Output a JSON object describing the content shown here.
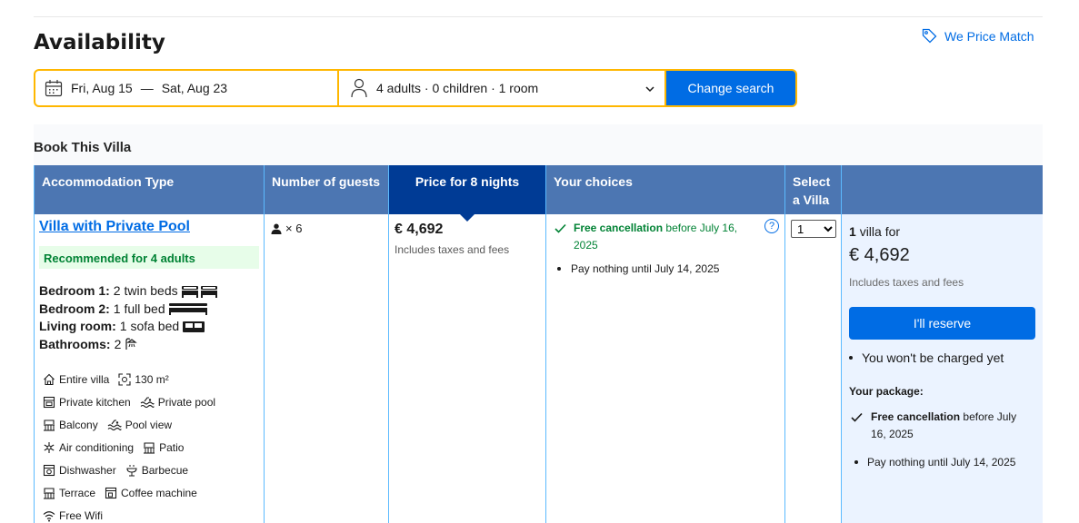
{
  "header": {
    "title": "Availability",
    "price_match": "We Price Match"
  },
  "search": {
    "check_in": "Fri, Aug 15",
    "separator": "—",
    "check_out": "Sat, Aug 23",
    "guests": "4 adults · 0 children · 1 room",
    "button": "Change search"
  },
  "book": {
    "title": "Book This Villa"
  },
  "table": {
    "headers": {
      "accommodation": "Accommodation Type",
      "guests": "Number of guests",
      "price": "Price for 8 nights",
      "choices": "Your choices",
      "select": "Select a Villa"
    },
    "villa": {
      "name": "Villa with Private Pool",
      "recommended": "Recommended for 4 adults",
      "bedrooms": [
        {
          "label": "Bedroom 1:",
          "value": "2 twin beds"
        },
        {
          "label": "Bedroom 2:",
          "value": "1 full bed"
        },
        {
          "label": "Living room:",
          "value": "1 sofa bed"
        },
        {
          "label": "Bathrooms:",
          "value": "2"
        }
      ],
      "facilities": [
        [
          "Entire villa",
          "130 m²"
        ],
        [
          "Private kitchen",
          "Private pool"
        ],
        [
          "Balcony",
          "Pool view"
        ],
        [
          "Air conditioning",
          "Patio"
        ],
        [
          "Dishwasher",
          "Barbecue"
        ],
        [
          "Terrace",
          "Coffee machine"
        ],
        [
          "Free Wifi"
        ]
      ]
    },
    "guests_count": "× 6",
    "price": "€ 4,692",
    "price_note": "Includes taxes and fees",
    "choices": {
      "free_cancel_bold": "Free cancellation",
      "free_cancel_rest": "before July 16, 2025",
      "pay_nothing": "Pay nothing until July 14, 2025",
      "help": "?"
    },
    "select_value": "1"
  },
  "summary": {
    "count": "1",
    "villa_for": "villa for",
    "price": "€ 4,692",
    "price_note": "Includes taxes and fees",
    "reserve": "I'll reserve",
    "not_charged": "You won't be charged yet",
    "package_title": "Your package:",
    "pkg_cancel_bold": "Free cancellation",
    "pkg_cancel_rest": "before July 16, 2025",
    "pkg_pay": "Pay nothing until July 14, 2025"
  },
  "colors": {
    "accent": "#006ce4",
    "header": "#4c76b2",
    "header_active": "#003b95",
    "search_border": "#ffb700",
    "green": "#008234"
  }
}
